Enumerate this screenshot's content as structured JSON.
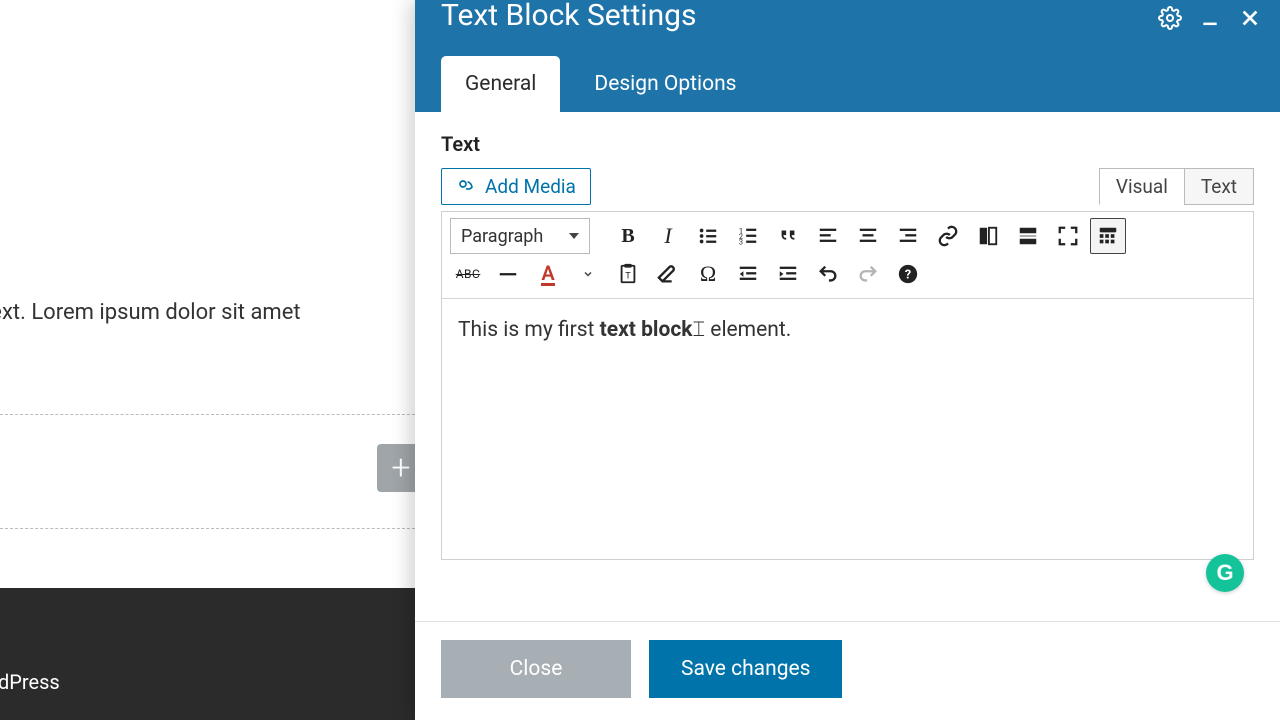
{
  "background": {
    "lorem": "nge this text. Lorem ipsum dolor sit amet",
    "footer_text": "ordPress"
  },
  "modal": {
    "title": "Text Block Settings",
    "tabs": {
      "general": "General",
      "design": "Design Options"
    },
    "field_label": "Text",
    "add_media": "Add Media",
    "view_tabs": {
      "visual": "Visual",
      "text": "Text"
    },
    "format_dropdown": "Paragraph",
    "content": {
      "prefix": "This is my first ",
      "bold": "text block",
      "suffix": " element."
    },
    "buttons": {
      "close": "Close",
      "save": "Save changes"
    }
  },
  "grammarly_letter": "G"
}
